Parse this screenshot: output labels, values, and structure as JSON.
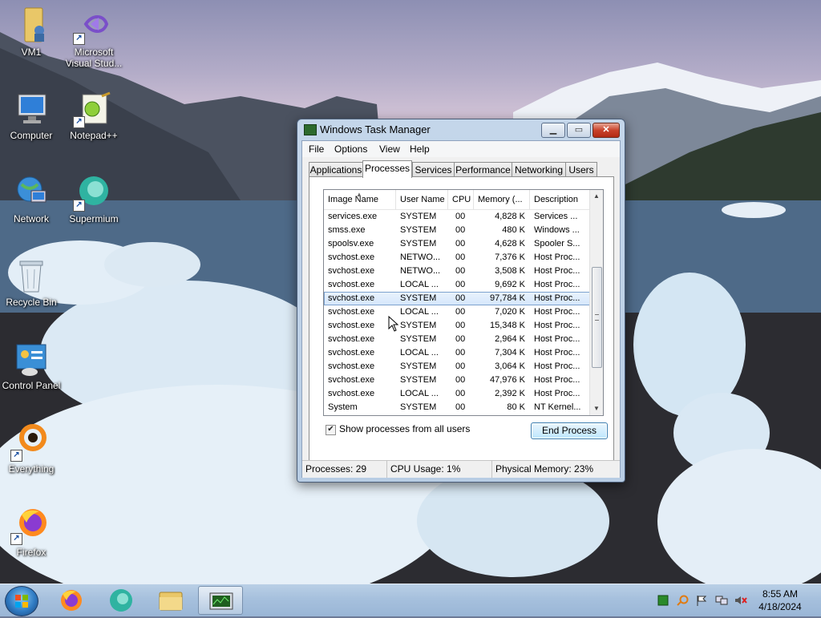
{
  "desktop": {
    "icons": [
      {
        "label": "VM1",
        "shortcut": false
      },
      {
        "label": "Microsoft Visual Stud...",
        "shortcut": true
      },
      {
        "label": "Computer",
        "shortcut": false
      },
      {
        "label": "Notepad++",
        "shortcut": true
      },
      {
        "label": "Network",
        "shortcut": false
      },
      {
        "label": "Supermium",
        "shortcut": true
      },
      {
        "label": "Recycle Bin",
        "shortcut": false
      },
      {
        "label": "Control Panel",
        "shortcut": false
      },
      {
        "label": "Everything",
        "shortcut": true
      },
      {
        "label": "Firefox",
        "shortcut": true
      }
    ]
  },
  "window": {
    "title": "Windows Task Manager",
    "menu": [
      "File",
      "Options",
      "View",
      "Help"
    ],
    "tabs": [
      "Applications",
      "Processes",
      "Services",
      "Performance",
      "Networking",
      "Users"
    ],
    "active_tab": "Processes",
    "columns": [
      "Image Name",
      "User Name",
      "CPU",
      "Memory (...",
      "Description"
    ],
    "processes": [
      {
        "image": "services.exe",
        "user": "SYSTEM",
        "cpu": "00",
        "memory": "4,828 K",
        "desc": "Services ..."
      },
      {
        "image": "smss.exe",
        "user": "SYSTEM",
        "cpu": "00",
        "memory": "480 K",
        "desc": "Windows ..."
      },
      {
        "image": "spoolsv.exe",
        "user": "SYSTEM",
        "cpu": "00",
        "memory": "4,628 K",
        "desc": "Spooler S..."
      },
      {
        "image": "svchost.exe",
        "user": "NETWO...",
        "cpu": "00",
        "memory": "7,376 K",
        "desc": "Host Proc..."
      },
      {
        "image": "svchost.exe",
        "user": "NETWO...",
        "cpu": "00",
        "memory": "3,508 K",
        "desc": "Host Proc..."
      },
      {
        "image": "svchost.exe",
        "user": "LOCAL ...",
        "cpu": "00",
        "memory": "9,692 K",
        "desc": "Host Proc..."
      },
      {
        "image": "svchost.exe",
        "user": "SYSTEM",
        "cpu": "00",
        "memory": "97,784 K",
        "desc": "Host Proc...",
        "selected": true
      },
      {
        "image": "svchost.exe",
        "user": "LOCAL ...",
        "cpu": "00",
        "memory": "7,020 K",
        "desc": "Host Proc..."
      },
      {
        "image": "svchost.exe",
        "user": "SYSTEM",
        "cpu": "00",
        "memory": "15,348 K",
        "desc": "Host Proc..."
      },
      {
        "image": "svchost.exe",
        "user": "SYSTEM",
        "cpu": "00",
        "memory": "2,964 K",
        "desc": "Host Proc..."
      },
      {
        "image": "svchost.exe",
        "user": "LOCAL ...",
        "cpu": "00",
        "memory": "7,304 K",
        "desc": "Host Proc..."
      },
      {
        "image": "svchost.exe",
        "user": "SYSTEM",
        "cpu": "00",
        "memory": "3,064 K",
        "desc": "Host Proc..."
      },
      {
        "image": "svchost.exe",
        "user": "SYSTEM",
        "cpu": "00",
        "memory": "47,976 K",
        "desc": "Host Proc..."
      },
      {
        "image": "svchost.exe",
        "user": "LOCAL ...",
        "cpu": "00",
        "memory": "2,392 K",
        "desc": "Host Proc..."
      },
      {
        "image": "System",
        "user": "SYSTEM",
        "cpu": "00",
        "memory": "80 K",
        "desc": "NT Kernel..."
      }
    ],
    "show_all_users_label": "Show processes from all users",
    "show_all_users_checked": true,
    "end_process_label": "End Process",
    "status": {
      "processes": "Processes: 29",
      "cpu": "CPU Usage: 1%",
      "memory": "Physical Memory: 23%"
    }
  },
  "taskbar": {
    "pinned": [
      "start-button",
      "firefox",
      "supermium",
      "file-explorer",
      "task-manager"
    ],
    "active": "task-manager",
    "clock_time": "8:55 AM",
    "clock_date": "4/18/2024"
  },
  "colors": {
    "selection": "#d4e6fb",
    "titlebar": "#c4d6ea",
    "taskbar": "#a6c0dd",
    "close_button": "#c8422b"
  }
}
